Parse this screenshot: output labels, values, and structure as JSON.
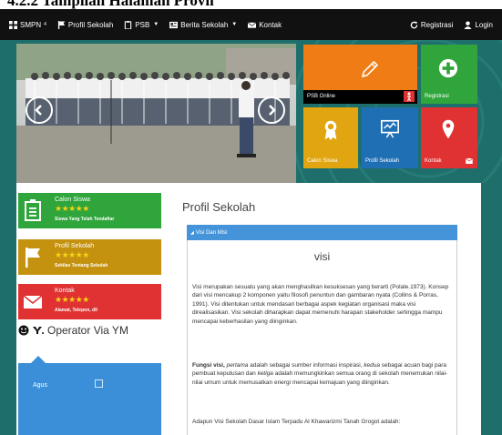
{
  "document": {
    "heading": "4.2.2        Tampilan Halaman Provil"
  },
  "navbar": {
    "brand": "SMPN",
    "brand_sup": "4",
    "items": [
      {
        "label": "Profil Sekolah",
        "icon": "flag-icon",
        "dropdown": false
      },
      {
        "label": "PSB",
        "icon": "clipboard-icon",
        "dropdown": true
      },
      {
        "label": "Berita Sekolah",
        "icon": "news-icon",
        "dropdown": true
      },
      {
        "label": "Kontak",
        "icon": "envelope-icon",
        "dropdown": false
      }
    ],
    "right": [
      {
        "label": "Registrasi",
        "icon": "refresh-icon"
      },
      {
        "label": "Login",
        "icon": "user-icon"
      }
    ]
  },
  "colors": {
    "background": "#1e6f6b",
    "orange": "#f07c16",
    "green": "#2fa53b",
    "gold": "#e1a512",
    "blue": "#1f6fb5",
    "red": "#e03232",
    "accordion": "#4594d9"
  },
  "tiles": {
    "psb_online": "PSB Online",
    "registrasi": "Registrasi",
    "calon_siswa": "Calon Siswa",
    "profil_sekolah": "Profil Sekolah",
    "kontak": "Kontak"
  },
  "sidebar": {
    "items": [
      {
        "title": "Calon Siswa",
        "stars": "★★★★★",
        "subtitle": "Siswa Yang Telah Tendaftar",
        "icon": "clipboard-icon"
      },
      {
        "title": "Profil Sekolah",
        "stars": "★★★★★",
        "subtitle": "Sekilas Tentang Sekolah",
        "icon": "flag-icon"
      },
      {
        "title": "Kontak",
        "stars": "★★★★★",
        "subtitle": "Alamat, Telepon, dll",
        "icon": "envelope-icon"
      }
    ],
    "ym_title": "Operator Via YM",
    "ym_user": "Agus"
  },
  "main": {
    "title": "Profil Sekolah",
    "accordion_label": "Visi Dan Misi",
    "section_heading": "visi",
    "paragraph1": "Visi merupakan sesuatu yang akan menghasilkan kesuksesan yang berarti (Polale.1973). Konsep dari visi mencakup 2 komponen yaitu filosofi penuntun dan gambaran nyata (Collins & Porras, 1991). Visi ditentukan untuk mendasari berbagai aspek kegiatan organisasi maka visi direalisasikan. Visi sekolah diharapkan dapat memenuhi harapan stakeholder sehingga mampu mencapai keberhasilan yang diinginkan.",
    "p2_bold": "Fungsi visi,",
    "p2_em1": "pertama",
    "p2_text1": "adalah sebagai sumber informasi inspirasi,",
    "p2_em2": "kedua",
    "p2_text2": "sebagai acuan bagi para pembuat keputusan dan",
    "p2_em3": "ketiga",
    "p2_text3": "adalah memungkinkan semua orang di sekolah menemukan nilai-nilai umum untuk memusatkan energi mencapai kemajuan yang diinginkan.",
    "paragraph3": "Adapun Visi Sekolah Dasar Islam Terpadu Al Khawarizmi Tanah Grogot adalah:"
  }
}
